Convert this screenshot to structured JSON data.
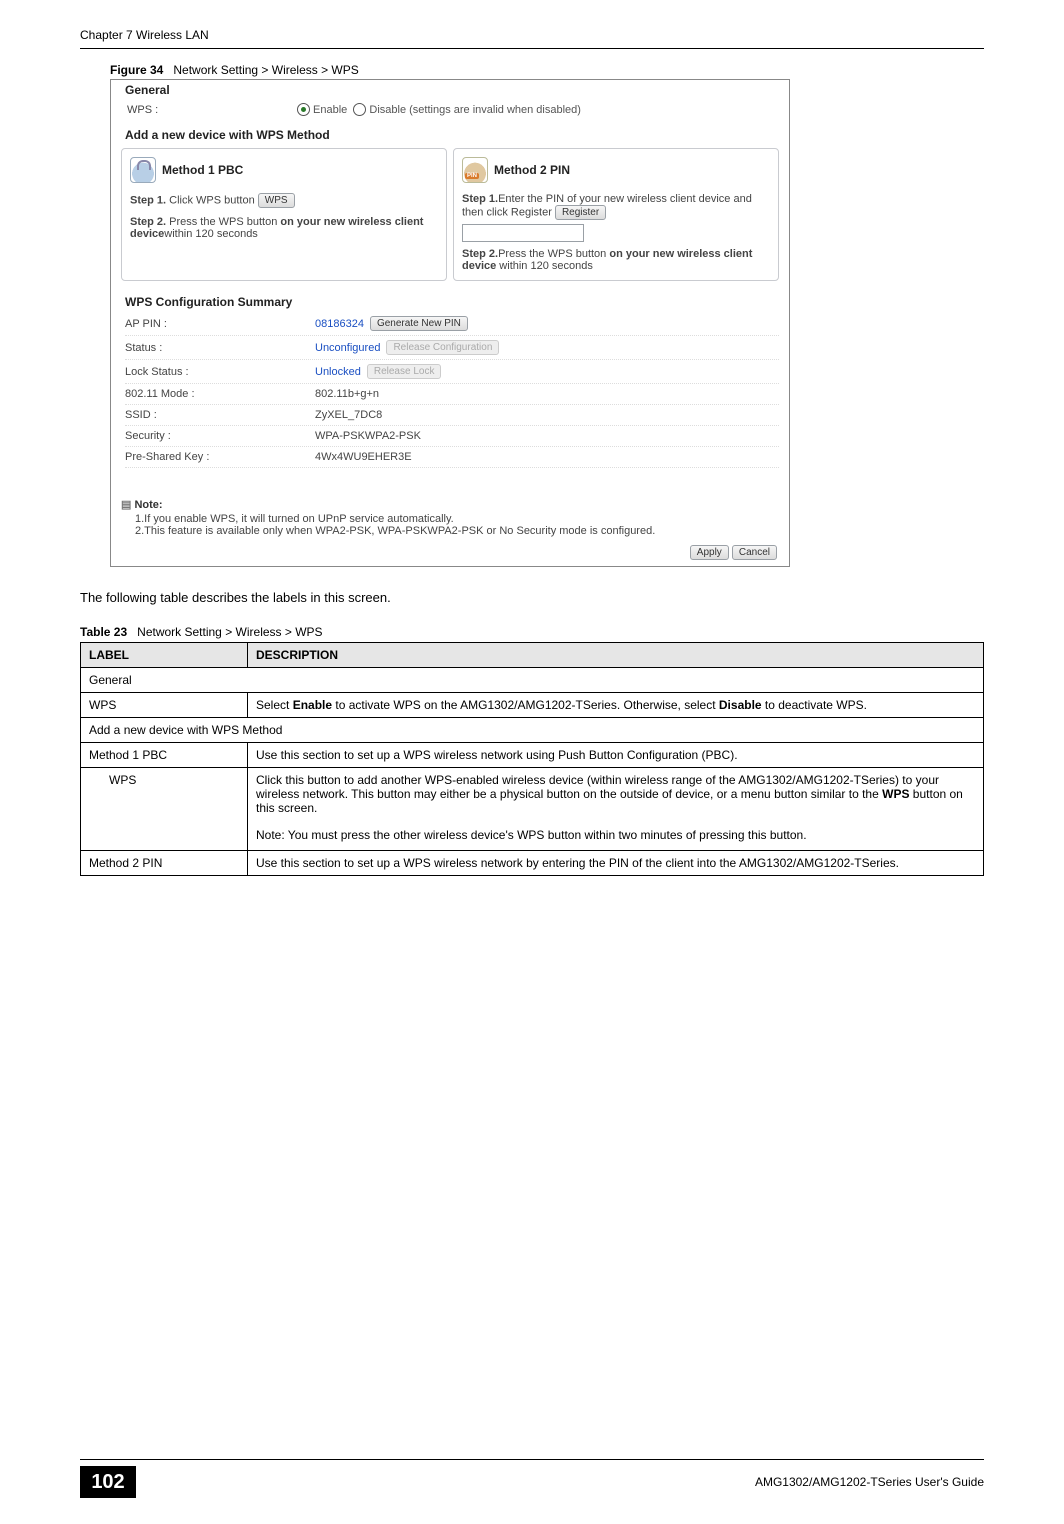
{
  "running_header": "Chapter 7 Wireless LAN",
  "figure_caption_prefix": "Figure 34",
  "figure_caption": "Network Setting > Wireless > WPS",
  "screenshot": {
    "general_title": "General",
    "wps_label": "WPS :",
    "enable_label": "Enable",
    "disable_label": "Disable (settings are invalid when disabled)",
    "add_title": "Add a new device with WPS Method",
    "method1": {
      "title": "Method 1 PBC",
      "step1_prefix": "Step 1.",
      "step1_text": " Click WPS button",
      "wps_btn": "WPS",
      "step2_prefix": "Step 2.",
      "step2_text_a": " Press the WPS button ",
      "step2_bold": "on your new wireless client device",
      "step2_text_b": "within 120 seconds"
    },
    "method2": {
      "title": "Method 2 PIN",
      "step1_prefix": "Step 1.",
      "step1_text": "Enter the PIN of your new wireless client device and then click Register",
      "register_btn": "Register",
      "step2_prefix": "Step 2.",
      "step2_text_a": "Press the WPS button ",
      "step2_bold": "on your new wireless client device",
      "step2_text_b": " within 120 seconds"
    },
    "summary_title": "WPS Configuration Summary",
    "summary_rows": [
      {
        "label": "AP PIN :",
        "value": "08186324",
        "value_class": "link-blue",
        "btn": "Generate New PIN",
        "btn_disabled": false
      },
      {
        "label": "Status :",
        "value": "Unconfigured",
        "value_class": "link-blue",
        "btn": "Release Configuration",
        "btn_disabled": true
      },
      {
        "label": "Lock Status :",
        "value": "Unlocked",
        "value_class": "link-blue",
        "btn": "Release Lock",
        "btn_disabled": true
      },
      {
        "label": "802.11 Mode :",
        "value": "802.11b+g+n",
        "value_class": "",
        "btn": "",
        "btn_disabled": false
      },
      {
        "label": "SSID :",
        "value": "ZyXEL_7DC8",
        "value_class": "",
        "btn": "",
        "btn_disabled": false
      },
      {
        "label": "Security :",
        "value": "WPA-PSKWPA2-PSK",
        "value_class": "",
        "btn": "",
        "btn_disabled": false
      },
      {
        "label": "Pre-Shared Key :",
        "value": "4Wx4WU9EHER3E",
        "value_class": "",
        "btn": "",
        "btn_disabled": false
      }
    ],
    "note_title": "Note:",
    "note_1": "1.If you enable WPS, it will turned on UPnP service automatically.",
    "note_2": "2.This feature is available only when WPA2-PSK, WPA-PSKWPA2-PSK or No Security mode is configured.",
    "apply_btn": "Apply",
    "cancel_btn": "Cancel"
  },
  "body_text": "The following table describes the labels in this screen.",
  "table_caption_prefix": "Table 23",
  "table_caption": "Network Setting > Wireless > WPS",
  "table": {
    "col1": "LABEL",
    "col2": "DESCRIPTION",
    "rows": [
      {
        "span": true,
        "text": "General"
      },
      {
        "label": "WPS",
        "desc_html": "Select <b>Enable</b> to activate WPS on the AMG1302/AMG1202-TSeries. Otherwise, select <b>Disable</b> to deactivate WPS."
      },
      {
        "span": true,
        "text": "Add a new device with WPS Method"
      },
      {
        "label": "Method 1 PBC",
        "desc_html": "Use this section to set up a WPS wireless network using Push Button Configuration (PBC)."
      },
      {
        "label": "WPS",
        "indent": true,
        "desc_html": "Click this button to add another WPS-enabled wireless device (within wireless range of the AMG1302/AMG1202-TSeries) to your wireless network. This button may either be a physical button on the outside of device, or a menu button similar to the <b>WPS</b> button on this screen.<div class='note-inline'>Note: You must press the other wireless device's WPS button within two minutes of pressing this button.</div>"
      },
      {
        "label": "Method 2 PIN",
        "desc_html": "Use this section to set up a WPS wireless network by entering the PIN of the client into the AMG1302/AMG1202-TSeries."
      }
    ]
  },
  "footer": {
    "page": "102",
    "guide": "AMG1302/AMG1202-TSeries User's Guide"
  }
}
